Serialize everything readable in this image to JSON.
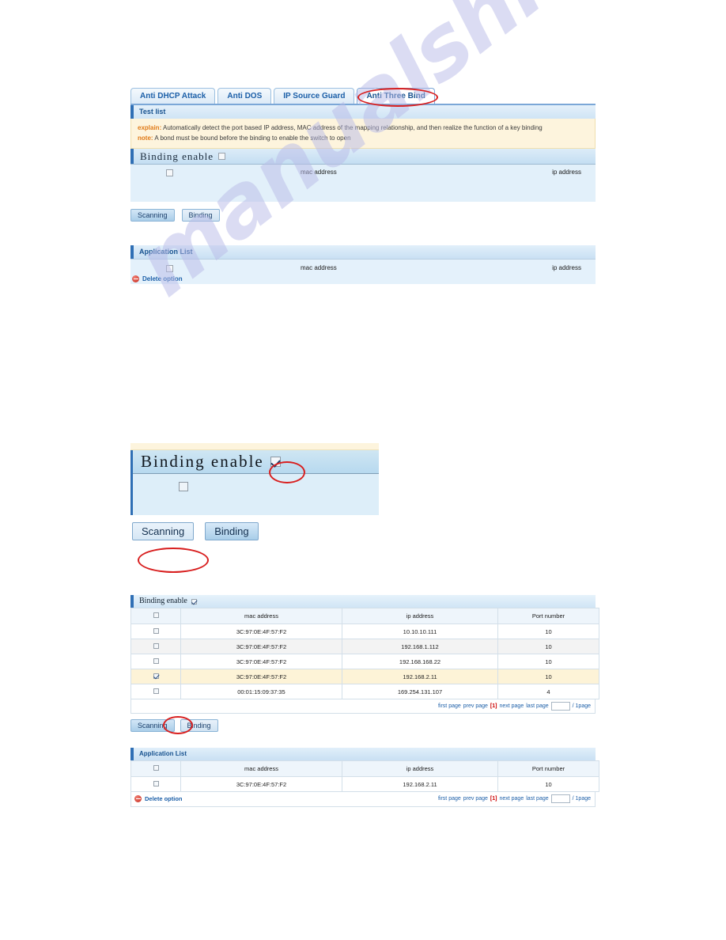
{
  "watermark": {
    "text": "manualshive.com"
  },
  "top": {
    "tabs": [
      {
        "label": "Anti DHCP Attack",
        "active": false
      },
      {
        "label": "Anti DOS",
        "active": false
      },
      {
        "label": "IP Source Guard",
        "active": false
      },
      {
        "label": "Anti Three Bind",
        "active": true
      }
    ],
    "test_list_title": "Test list",
    "explain_kw": "explain:",
    "explain_text": "Automatically detect the port based IP address, MAC address of the mapping relationship, and then realize the function of a key binding",
    "note_kw": "note:",
    "note_text": "A bond must be bound before the binding to enable the switch to open",
    "binding_enable_label": "Binding enable",
    "binding_enable_checked": false,
    "col_mac": "mac address",
    "col_ip": "ip address",
    "btn_scanning": "Scanning",
    "btn_binding": "Binding",
    "application_list_title": "Application List",
    "delete_option": "Delete option"
  },
  "mid": {
    "binding_enable_label": "Binding enable",
    "binding_enable_checked": true,
    "btn_scanning": "Scanning",
    "btn_binding": "Binding"
  },
  "bottom": {
    "binding_enable_label": "Binding enable",
    "binding_enable_checked": true,
    "columns": [
      "",
      "mac address",
      "ip address",
      "Port number"
    ],
    "rows": [
      {
        "checked": false,
        "mac": "3C:97:0E:4F:57:F2",
        "ip": "10.10.10.111",
        "port": "10"
      },
      {
        "checked": false,
        "mac": "3C:97:0E:4F:57:F2",
        "ip": "192.168.1.112",
        "port": "10"
      },
      {
        "checked": false,
        "mac": "3C:97:0E:4F:57:F2",
        "ip": "192.168.168.22",
        "port": "10"
      },
      {
        "checked": true,
        "mac": "3C:97:0E:4F:57:F2",
        "ip": "192.168.2.11",
        "port": "10"
      },
      {
        "checked": false,
        "mac": "00:01:15:09:37:35",
        "ip": "169.254.131.107",
        "port": "4"
      }
    ],
    "pager": {
      "first": "first page",
      "prev": "prev page",
      "current": "[1]",
      "next": "next page",
      "last": "last page",
      "input_value": "",
      "suffix": "/ 1page"
    },
    "btn_scanning": "Scanning",
    "btn_binding": "Binding",
    "application_list_title": "Application List",
    "app_columns": [
      "",
      "mac address",
      "ip address",
      "Port number"
    ],
    "app_rows": [
      {
        "checked": false,
        "mac": "3C:97:0E:4F:57:F2",
        "ip": "192.168.2.11",
        "port": "10"
      }
    ],
    "delete_option": "Delete option",
    "app_pager": {
      "first": "first page",
      "prev": "prev page",
      "current": "[1]",
      "next": "next page",
      "last": "last page",
      "input_value": "",
      "suffix": "/ 1page"
    }
  },
  "colors": {
    "accent": "#2f6fb5",
    "annotation": "#d81f1f",
    "note_bg": "#fdf4dd",
    "panel_bg": "#e2f0fa",
    "selected_row": "#fdf3d7"
  }
}
